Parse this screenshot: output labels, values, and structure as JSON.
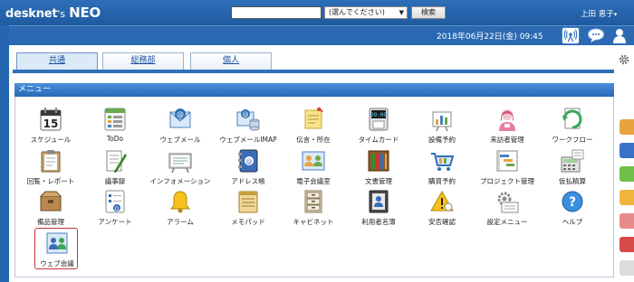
{
  "header": {
    "logo_main": "desknet",
    "logo_apos": "'s",
    "logo_neo": "NEO",
    "search_placeholder": "",
    "search_select": "(選んでください)",
    "search_button": "検索",
    "user_name": "上田 恵子",
    "user_caret": "▾"
  },
  "subbar": {
    "datetime": "2018年06月22日(金) 09:45"
  },
  "tabs": [
    {
      "label": "共通"
    },
    {
      "label": "総務部"
    },
    {
      "label": "個人"
    }
  ],
  "menu": {
    "title": "メニュー",
    "items": [
      {
        "label": "スケジュール",
        "icon": "calendar-icon"
      },
      {
        "label": "ToDo",
        "icon": "todo-icon"
      },
      {
        "label": "ウェブメール",
        "icon": "webmail-icon"
      },
      {
        "label": "ウェブメールIMAP",
        "icon": "webmail-imap-icon"
      },
      {
        "label": "伝言・所在",
        "icon": "message-icon"
      },
      {
        "label": "タイムカード",
        "icon": "timecard-icon"
      },
      {
        "label": "設備予約",
        "icon": "facility-icon"
      },
      {
        "label": "来訪者管理",
        "icon": "visitor-icon"
      },
      {
        "label": "ワークフロー",
        "icon": "workflow-icon"
      },
      {
        "label": "回覧・レポート",
        "icon": "circular-icon"
      },
      {
        "label": "議事録",
        "icon": "minutes-icon"
      },
      {
        "label": "インフォメーション",
        "icon": "information-icon"
      },
      {
        "label": "アドレス帳",
        "icon": "addressbook-icon"
      },
      {
        "label": "電子会議室",
        "icon": "forum-icon"
      },
      {
        "label": "文書管理",
        "icon": "document-icon"
      },
      {
        "label": "購買予約",
        "icon": "purchase-icon"
      },
      {
        "label": "プロジェクト管理",
        "icon": "project-icon"
      },
      {
        "label": "仮払精算",
        "icon": "expense-icon"
      },
      {
        "label": "備品管理",
        "icon": "equipment-icon"
      },
      {
        "label": "アンケート",
        "icon": "survey-icon"
      },
      {
        "label": "アラーム",
        "icon": "alarm-icon"
      },
      {
        "label": "メモパッド",
        "icon": "memopad-icon"
      },
      {
        "label": "キャビネット",
        "icon": "cabinet-icon"
      },
      {
        "label": "利用者名簿",
        "icon": "userlist-icon"
      },
      {
        "label": "安否確認",
        "icon": "safety-icon"
      },
      {
        "label": "設定メニュー",
        "icon": "settings-icon"
      },
      {
        "label": "ヘルプ",
        "icon": "help-icon"
      },
      {
        "label": "ウェブ会議",
        "icon": "webmeeting-icon"
      }
    ]
  },
  "calendar_day": "15",
  "timecard_display": "09:00",
  "colors": {
    "brand_blue": "#2d6fb8",
    "selected_border": "#c8353a",
    "side_tabs": [
      "#e8a33d",
      "#3b72c8",
      "#6fbf4a",
      "#f0b53c",
      "#e88b8b",
      "#d94a4a",
      "#dcdcdc"
    ]
  }
}
